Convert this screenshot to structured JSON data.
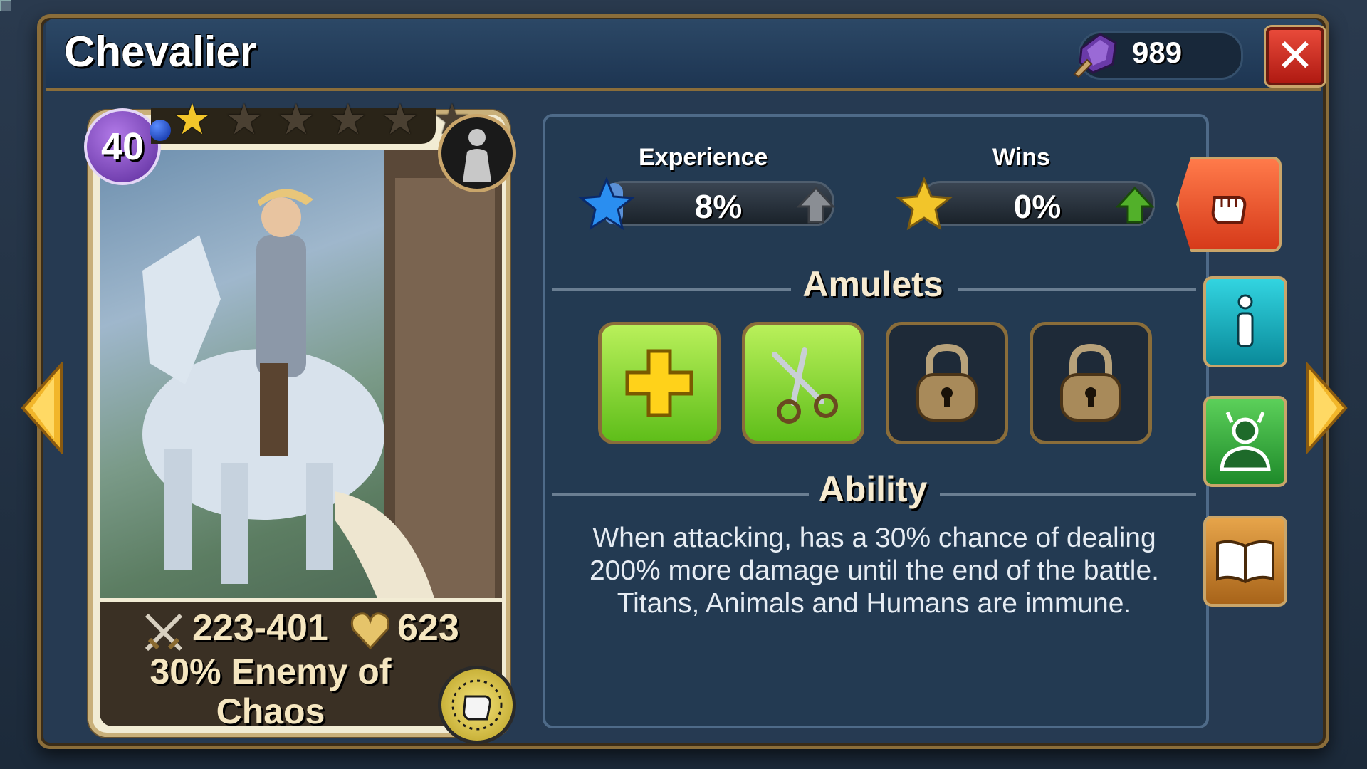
{
  "hero": {
    "name": "Chevalier",
    "level": "40",
    "stars_filled": 1,
    "stars_total": 6,
    "attack": "223-401",
    "health": "623",
    "perk": "30% Enemy of Chaos"
  },
  "currency": {
    "amount": "989",
    "icon": "purple-crystal-icon"
  },
  "progress": {
    "experience_label": "Experience",
    "experience_value": "8%",
    "experience_fraction": 0.08,
    "wins_label": "Wins",
    "wins_value": "0%",
    "wins_fraction": 0.0
  },
  "amulets": {
    "title": "Amulets",
    "slots": [
      {
        "type": "add",
        "icon": "plus-icon"
      },
      {
        "type": "remove",
        "icon": "scissors-icon"
      },
      {
        "type": "locked",
        "icon": "lock-icon"
      },
      {
        "type": "locked",
        "icon": "lock-icon"
      }
    ]
  },
  "ability": {
    "title": "Ability",
    "description": "When attacking, has a 30% chance of dealing 200% more damage until the end of the battle. Titans, Animals and Humans are immune."
  },
  "side_buttons": [
    {
      "name": "fight",
      "icon": "fist-icon",
      "color": "#e85a2a"
    },
    {
      "name": "info",
      "icon": "info-icon",
      "color": "#1ab6c4"
    },
    {
      "name": "evolve",
      "icon": "hero-silhouette-icon",
      "color": "#3cb44a"
    },
    {
      "name": "lore",
      "icon": "book-icon",
      "color": "#c88a3a"
    }
  ],
  "colors": {
    "window_bg": "#263a52",
    "gold_border": "#8a6d3a",
    "close_red": "#d0281a",
    "amulet_green": "#8ddc3a"
  }
}
